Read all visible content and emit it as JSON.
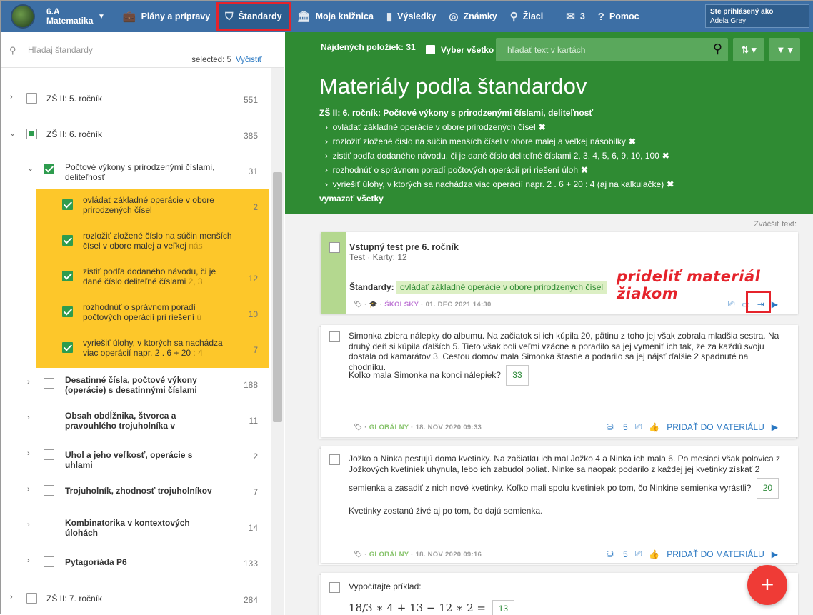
{
  "topbar": {
    "class_name": "6.A",
    "subject": "Matematika",
    "nav": [
      {
        "label": "Plány a prípravy",
        "icon": "briefcase-icon"
      },
      {
        "label": "Štandardy",
        "icon": "shield-icon"
      },
      {
        "label": "Moja knižnica",
        "icon": "library-icon"
      },
      {
        "label": "Výsledky",
        "icon": "bar-chart-icon"
      },
      {
        "label": "Známky",
        "icon": "grades-icon"
      },
      {
        "label": "Žiaci",
        "icon": "students-icon"
      }
    ],
    "messages_count": "3",
    "help": "Pomoc",
    "user_label": "Ste prihlásený ako",
    "user_name": "Adela Grey"
  },
  "sidebar": {
    "search_placeholder": "Hľadaj štandardy",
    "selected_label": "selected: 5",
    "clear_label": "Vyčistiť",
    "grades": [
      {
        "label": "ZŠ II: 5. ročník",
        "count": "551"
      },
      {
        "label": "ZŠ II: 6. ročník",
        "count": "385"
      },
      {
        "label": "ZŠ II: 7. ročník",
        "count": "284"
      }
    ],
    "topic_open": {
      "label": "Počtové výkony s prirodzenými číslami, deliteľnosť",
      "count": "31"
    },
    "subitems": [
      {
        "l1": "ovládať základné operácie v obore",
        "l2": "prirodzených čísel",
        "fade": "",
        "count": "2"
      },
      {
        "l1": "rozložiť zložené číslo na súčin menších",
        "l2": "čísel v obore malej a veľkej ",
        "fade": "nás",
        "count": ""
      },
      {
        "l1": "zistiť podľa dodaného návodu, či je",
        "l2": "dané číslo deliteľné číslami ",
        "fade": "2, 3",
        "count": "12"
      },
      {
        "l1": "rozhodnúť o správnom poradí",
        "l2": "počtových operácií pri riešení ",
        "fade": "ú",
        "count": "10"
      },
      {
        "l1": "vyriešiť úlohy, v ktorých sa nachádza",
        "l2": "viac operácií napr. 2 . 6 + 20 ",
        "fade": ": 4",
        "count": "7"
      }
    ],
    "topics": [
      {
        "l1": "Desatinné čísla, počtové výkony",
        "l2": "(operácie) s desatinnými číslami",
        "count": "188"
      },
      {
        "l1": "Obsah obdĺžnika, štvorca a",
        "l2": "pravouhlého trojuholníka v",
        "count": "11"
      },
      {
        "l1": "Uhol a jeho veľkosť, operácie s uhlami",
        "l2": "",
        "count": "2"
      },
      {
        "l1": "Trojuholník, zhodnosť trojuholníkov",
        "l2": "",
        "count": "7"
      },
      {
        "l1": "Kombinatorika v kontextových",
        "l2": "úlohách",
        "count": "14"
      },
      {
        "l1": "Pytagoriáda P6",
        "l2": "",
        "count": "133"
      }
    ]
  },
  "header": {
    "found": "Nájdených položiek: 31",
    "select_all": "Vyber všetko",
    "search_placeholder": "hľadať text v kartách",
    "title": "Materiály podľa štandardov",
    "subtitle": "ZŠ II: 6. ročník: Počtové výkony s prirodzenými číslami, deliteľnosť",
    "standards": [
      "ovládať základné operácie v obore prirodzených čísel",
      "rozložiť zložené číslo na súčin menších čísel v obore malej a veľkej násobilky",
      "zistiť podľa dodaného návodu, či je dané číslo deliteľné číslami 2, 3, 4, 5, 6, 9, 10, 100",
      "rozhodnúť o správnom poradí počtových operácií pri riešení úloh",
      "vyriešiť úlohy, v ktorých sa nachádza viac operácií napr. 2 . 6 + 20 : 4 (aj na kalkulačke)"
    ],
    "clear_all": "vymazať všetky",
    "zoom": "Zväčšiť text:"
  },
  "card1": {
    "title": "Vstupný test pre 6. ročník",
    "subtitle": "Test · Karty: 12",
    "std_label": "Štandardy:",
    "std_tag": "ovládať základné operácie v obore prirodzených čísel",
    "scope": "ŠKOLSKÝ",
    "date": "01. DEC 2021 14:30"
  },
  "card2": {
    "text": "Simonka zbiera nálepky do albumu. Na začiatok si ich kúpila 20, pätinu z toho jej však zobrala mladšia sestra. Na druhý deň si kúpila ďalších 5. Tieto však boli veľmi vzácne a poradilo sa jej vymeniť ich tak, že za každú svoju dostala od kamarátov 3. Cestou domov mala Simonka šťastie a podarilo sa jej nájsť ďalšie 2 spadnuté na chodníku.",
    "question": "Koľko mala Simonka na konci nálepiek?",
    "answer": "33",
    "scope": "GLOBÁLNY",
    "date": "18. NOV 2020 09:33",
    "copies": "5",
    "add": "PRIDAŤ DO MATERIÁLU"
  },
  "card3": {
    "text1": "Jožko a Ninka pestujú doma kvetinky. Na začiatku ich mal Jožko 4 a Ninka ich mala 6. Po mesiaci však polovica z Jožkových kvetiniek uhynula, lebo ich zabudol poliať. Ninke sa naopak podarilo z každej jej kvetinky získať 2",
    "text2": "semienka a zasadiť z nich nové kvetinky. Koľko mali spolu kvetiniek po tom, čo Ninkine semienka vyrástli?",
    "answer": "20",
    "text3": "Kvetinky zostanú živé aj po tom, čo dajú semienka.",
    "scope": "GLOBÁLNY",
    "date": "18. NOV 2020 09:16",
    "copies": "5",
    "add": "PRIDAŤ DO MATERIÁLU"
  },
  "card4": {
    "text": "Vypočítajte príklad:",
    "formula": "18/3 ∗ 4 + 13 − 12 ∗ 2 =",
    "answer": "13"
  },
  "annotation": "prideliť materiál žiakom",
  "fab": "+"
}
